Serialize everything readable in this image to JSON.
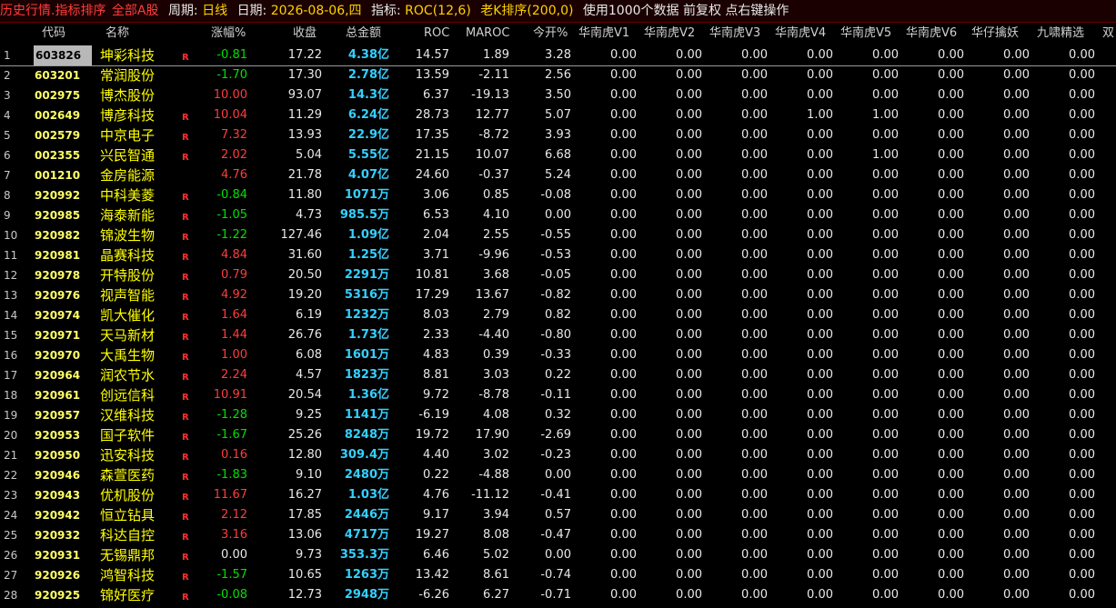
{
  "title": {
    "mode": "历史行情.指标排序",
    "scope": "全部A股",
    "period_label": "周期:",
    "period": "日线",
    "date_label": "日期:",
    "date": "2026-08-06,四",
    "indicator_label": "指标:",
    "indicator": "ROC(12,6)",
    "sort": "老K排序(200,0)",
    "note": "使用1000个数据 前复权 点右键操作"
  },
  "columns": {
    "code": "代码",
    "name": "名称",
    "change": "涨幅%",
    "close": "收盘",
    "amount": "总金额",
    "roc": "ROC",
    "maroc": "MAROC",
    "open_pct": "今开%",
    "v1": "华南虎V1",
    "v2": "华南虎V2",
    "v3": "华南虎V3",
    "v4": "华南虎V4",
    "v5": "华南虎V5",
    "v6": "华南虎V6",
    "hz": "华仔擒妖",
    "jx": "九啸精选",
    "extra": "双"
  },
  "flag_text": "R",
  "rows": [
    {
      "idx": "1",
      "code": "603826",
      "name": "坤彩科技",
      "flag": true,
      "chg": "-0.81",
      "close": "17.22",
      "amt": "4.38亿",
      "roc": "14.57",
      "maroc": "1.89",
      "open": "3.28",
      "v1": "0.00",
      "v2": "0.00",
      "v3": "0.00",
      "v4": "0.00",
      "v5": "0.00",
      "v6": "0.00",
      "hz": "0.00",
      "jx": "0.00"
    },
    {
      "idx": "2",
      "code": "603201",
      "name": "常润股份",
      "flag": false,
      "chg": "-1.70",
      "close": "17.30",
      "amt": "2.78亿",
      "roc": "13.59",
      "maroc": "-2.11",
      "open": "2.56",
      "v1": "0.00",
      "v2": "0.00",
      "v3": "0.00",
      "v4": "0.00",
      "v5": "0.00",
      "v6": "0.00",
      "hz": "0.00",
      "jx": "0.00"
    },
    {
      "idx": "3",
      "code": "002975",
      "name": "博杰股份",
      "flag": false,
      "chg": "10.00",
      "close": "93.07",
      "amt": "14.3亿",
      "roc": "6.37",
      "maroc": "-19.13",
      "open": "3.50",
      "v1": "0.00",
      "v2": "0.00",
      "v3": "0.00",
      "v4": "0.00",
      "v5": "0.00",
      "v6": "0.00",
      "hz": "0.00",
      "jx": "0.00"
    },
    {
      "idx": "4",
      "code": "002649",
      "name": "博彦科技",
      "flag": true,
      "chg": "10.04",
      "close": "11.29",
      "amt": "6.24亿",
      "roc": "28.73",
      "maroc": "12.77",
      "open": "5.07",
      "v1": "0.00",
      "v2": "0.00",
      "v3": "0.00",
      "v4": "1.00",
      "v5": "1.00",
      "v6": "0.00",
      "hz": "0.00",
      "jx": "0.00"
    },
    {
      "idx": "5",
      "code": "002579",
      "name": "中京电子",
      "flag": true,
      "chg": "7.32",
      "close": "13.93",
      "amt": "22.9亿",
      "roc": "17.35",
      "maroc": "-8.72",
      "open": "3.93",
      "v1": "0.00",
      "v2": "0.00",
      "v3": "0.00",
      "v4": "0.00",
      "v5": "0.00",
      "v6": "0.00",
      "hz": "0.00",
      "jx": "0.00"
    },
    {
      "idx": "6",
      "code": "002355",
      "name": "兴民智通",
      "flag": true,
      "chg": "2.02",
      "close": "5.04",
      "amt": "5.55亿",
      "roc": "21.15",
      "maroc": "10.07",
      "open": "6.68",
      "v1": "0.00",
      "v2": "0.00",
      "v3": "0.00",
      "v4": "0.00",
      "v5": "1.00",
      "v6": "0.00",
      "hz": "0.00",
      "jx": "0.00"
    },
    {
      "idx": "7",
      "code": "001210",
      "name": "金房能源",
      "flag": false,
      "chg": "4.76",
      "close": "21.78",
      "amt": "4.07亿",
      "roc": "24.60",
      "maroc": "-0.37",
      "open": "5.24",
      "v1": "0.00",
      "v2": "0.00",
      "v3": "0.00",
      "v4": "0.00",
      "v5": "0.00",
      "v6": "0.00",
      "hz": "0.00",
      "jx": "0.00"
    },
    {
      "idx": "8",
      "code": "920992",
      "name": "中科美菱",
      "flag": true,
      "chg": "-0.84",
      "close": "11.80",
      "amt": "1071万",
      "roc": "3.06",
      "maroc": "0.85",
      "open": "-0.08",
      "v1": "0.00",
      "v2": "0.00",
      "v3": "0.00",
      "v4": "0.00",
      "v5": "0.00",
      "v6": "0.00",
      "hz": "0.00",
      "jx": "0.00"
    },
    {
      "idx": "9",
      "code": "920985",
      "name": "海泰新能",
      "flag": true,
      "chg": "-1.05",
      "close": "4.73",
      "amt": "985.5万",
      "roc": "6.53",
      "maroc": "4.10",
      "open": "0.00",
      "v1": "0.00",
      "v2": "0.00",
      "v3": "0.00",
      "v4": "0.00",
      "v5": "0.00",
      "v6": "0.00",
      "hz": "0.00",
      "jx": "0.00"
    },
    {
      "idx": "10",
      "code": "920982",
      "name": "锦波生物",
      "flag": true,
      "chg": "-1.22",
      "close": "127.46",
      "amt": "1.09亿",
      "roc": "2.04",
      "maroc": "2.55",
      "open": "-0.55",
      "v1": "0.00",
      "v2": "0.00",
      "v3": "0.00",
      "v4": "0.00",
      "v5": "0.00",
      "v6": "0.00",
      "hz": "0.00",
      "jx": "0.00"
    },
    {
      "idx": "11",
      "code": "920981",
      "name": "晶赛科技",
      "flag": true,
      "chg": "4.84",
      "close": "31.60",
      "amt": "1.25亿",
      "roc": "3.71",
      "maroc": "-9.96",
      "open": "-0.53",
      "v1": "0.00",
      "v2": "0.00",
      "v3": "0.00",
      "v4": "0.00",
      "v5": "0.00",
      "v6": "0.00",
      "hz": "0.00",
      "jx": "0.00"
    },
    {
      "idx": "12",
      "code": "920978",
      "name": "开特股份",
      "flag": true,
      "chg": "0.79",
      "close": "20.50",
      "amt": "2291万",
      "roc": "10.81",
      "maroc": "3.68",
      "open": "-0.05",
      "v1": "0.00",
      "v2": "0.00",
      "v3": "0.00",
      "v4": "0.00",
      "v5": "0.00",
      "v6": "0.00",
      "hz": "0.00",
      "jx": "0.00"
    },
    {
      "idx": "13",
      "code": "920976",
      "name": "视声智能",
      "flag": true,
      "chg": "4.92",
      "close": "19.20",
      "amt": "5316万",
      "roc": "17.29",
      "maroc": "13.67",
      "open": "-0.82",
      "v1": "0.00",
      "v2": "0.00",
      "v3": "0.00",
      "v4": "0.00",
      "v5": "0.00",
      "v6": "0.00",
      "hz": "0.00",
      "jx": "0.00"
    },
    {
      "idx": "14",
      "code": "920974",
      "name": "凯大催化",
      "flag": true,
      "chg": "1.64",
      "close": "6.19",
      "amt": "1232万",
      "roc": "8.03",
      "maroc": "2.79",
      "open": "0.82",
      "v1": "0.00",
      "v2": "0.00",
      "v3": "0.00",
      "v4": "0.00",
      "v5": "0.00",
      "v6": "0.00",
      "hz": "0.00",
      "jx": "0.00"
    },
    {
      "idx": "15",
      "code": "920971",
      "name": "天马新材",
      "flag": true,
      "chg": "1.44",
      "close": "26.76",
      "amt": "1.73亿",
      "roc": "2.33",
      "maroc": "-4.40",
      "open": "-0.80",
      "v1": "0.00",
      "v2": "0.00",
      "v3": "0.00",
      "v4": "0.00",
      "v5": "0.00",
      "v6": "0.00",
      "hz": "0.00",
      "jx": "0.00"
    },
    {
      "idx": "16",
      "code": "920970",
      "name": "大禹生物",
      "flag": true,
      "chg": "1.00",
      "close": "6.08",
      "amt": "1601万",
      "roc": "4.83",
      "maroc": "0.39",
      "open": "-0.33",
      "v1": "0.00",
      "v2": "0.00",
      "v3": "0.00",
      "v4": "0.00",
      "v5": "0.00",
      "v6": "0.00",
      "hz": "0.00",
      "jx": "0.00"
    },
    {
      "idx": "17",
      "code": "920964",
      "name": "润农节水",
      "flag": true,
      "chg": "2.24",
      "close": "4.57",
      "amt": "1823万",
      "roc": "8.81",
      "maroc": "3.03",
      "open": "0.22",
      "v1": "0.00",
      "v2": "0.00",
      "v3": "0.00",
      "v4": "0.00",
      "v5": "0.00",
      "v6": "0.00",
      "hz": "0.00",
      "jx": "0.00"
    },
    {
      "idx": "18",
      "code": "920961",
      "name": "创远信科",
      "flag": true,
      "chg": "10.91",
      "close": "20.54",
      "amt": "1.36亿",
      "roc": "9.72",
      "maroc": "-8.78",
      "open": "-0.11",
      "v1": "0.00",
      "v2": "0.00",
      "v3": "0.00",
      "v4": "0.00",
      "v5": "0.00",
      "v6": "0.00",
      "hz": "0.00",
      "jx": "0.00"
    },
    {
      "idx": "19",
      "code": "920957",
      "name": "汉维科技",
      "flag": true,
      "chg": "-1.28",
      "close": "9.25",
      "amt": "1141万",
      "roc": "-6.19",
      "maroc": "4.08",
      "open": "0.32",
      "v1": "0.00",
      "v2": "0.00",
      "v3": "0.00",
      "v4": "0.00",
      "v5": "0.00",
      "v6": "0.00",
      "hz": "0.00",
      "jx": "0.00"
    },
    {
      "idx": "20",
      "code": "920953",
      "name": "国子软件",
      "flag": true,
      "chg": "-1.67",
      "close": "25.26",
      "amt": "8248万",
      "roc": "19.72",
      "maroc": "17.90",
      "open": "-2.69",
      "v1": "0.00",
      "v2": "0.00",
      "v3": "0.00",
      "v4": "0.00",
      "v5": "0.00",
      "v6": "0.00",
      "hz": "0.00",
      "jx": "0.00"
    },
    {
      "idx": "21",
      "code": "920950",
      "name": "迅安科技",
      "flag": true,
      "chg": "0.16",
      "close": "12.80",
      "amt": "309.4万",
      "roc": "4.40",
      "maroc": "3.02",
      "open": "-0.23",
      "v1": "0.00",
      "v2": "0.00",
      "v3": "0.00",
      "v4": "0.00",
      "v5": "0.00",
      "v6": "0.00",
      "hz": "0.00",
      "jx": "0.00"
    },
    {
      "idx": "22",
      "code": "920946",
      "name": "森萱医药",
      "flag": true,
      "chg": "-1.83",
      "close": "9.10",
      "amt": "2480万",
      "roc": "0.22",
      "maroc": "-4.88",
      "open": "0.00",
      "v1": "0.00",
      "v2": "0.00",
      "v3": "0.00",
      "v4": "0.00",
      "v5": "0.00",
      "v6": "0.00",
      "hz": "0.00",
      "jx": "0.00"
    },
    {
      "idx": "23",
      "code": "920943",
      "name": "优机股份",
      "flag": true,
      "chg": "11.67",
      "close": "16.27",
      "amt": "1.03亿",
      "roc": "4.76",
      "maroc": "-11.12",
      "open": "-0.41",
      "v1": "0.00",
      "v2": "0.00",
      "v3": "0.00",
      "v4": "0.00",
      "v5": "0.00",
      "v6": "0.00",
      "hz": "0.00",
      "jx": "0.00"
    },
    {
      "idx": "24",
      "code": "920942",
      "name": "恒立钻具",
      "flag": true,
      "chg": "2.12",
      "close": "17.85",
      "amt": "2446万",
      "roc": "9.17",
      "maroc": "3.94",
      "open": "0.57",
      "v1": "0.00",
      "v2": "0.00",
      "v3": "0.00",
      "v4": "0.00",
      "v5": "0.00",
      "v6": "0.00",
      "hz": "0.00",
      "jx": "0.00"
    },
    {
      "idx": "25",
      "code": "920932",
      "name": "科达自控",
      "flag": true,
      "chg": "3.16",
      "close": "13.06",
      "amt": "4717万",
      "roc": "19.27",
      "maroc": "8.08",
      "open": "-0.47",
      "v1": "0.00",
      "v2": "0.00",
      "v3": "0.00",
      "v4": "0.00",
      "v5": "0.00",
      "v6": "0.00",
      "hz": "0.00",
      "jx": "0.00"
    },
    {
      "idx": "26",
      "code": "920931",
      "name": "无锡鼎邦",
      "flag": true,
      "chg": "0.00",
      "close": "9.73",
      "amt": "353.3万",
      "roc": "6.46",
      "maroc": "5.02",
      "open": "0.00",
      "v1": "0.00",
      "v2": "0.00",
      "v3": "0.00",
      "v4": "0.00",
      "v5": "0.00",
      "v6": "0.00",
      "hz": "0.00",
      "jx": "0.00"
    },
    {
      "idx": "27",
      "code": "920926",
      "name": "鸿智科技",
      "flag": true,
      "chg": "-1.57",
      "close": "10.65",
      "amt": "1263万",
      "roc": "13.42",
      "maroc": "8.61",
      "open": "-0.74",
      "v1": "0.00",
      "v2": "0.00",
      "v3": "0.00",
      "v4": "0.00",
      "v5": "0.00",
      "v6": "0.00",
      "hz": "0.00",
      "jx": "0.00"
    },
    {
      "idx": "28",
      "code": "920925",
      "name": "锦好医疗",
      "flag": true,
      "chg": "-0.08",
      "close": "12.73",
      "amt": "2948万",
      "roc": "-6.26",
      "maroc": "6.27",
      "open": "-0.71",
      "v1": "0.00",
      "v2": "0.00",
      "v3": "0.00",
      "v4": "0.00",
      "v5": "0.00",
      "v6": "0.00",
      "hz": "0.00",
      "jx": "0.00"
    }
  ]
}
